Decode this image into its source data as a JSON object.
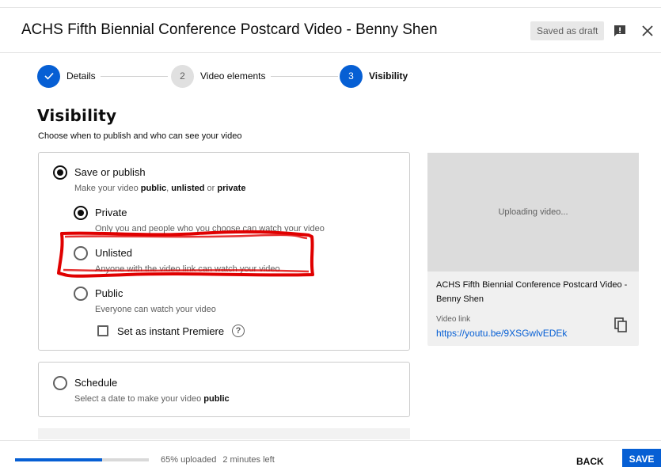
{
  "header": {
    "title": "ACHS Fifth Biennial Conference Postcard Video - Benny Shen",
    "draft_status": "Saved as draft",
    "feedback_icon": "feedback-icon",
    "close_icon": "close-icon"
  },
  "stepper": {
    "steps": [
      {
        "number": "✓",
        "label": "Details",
        "state": "done"
      },
      {
        "number": "2",
        "label": "Video elements",
        "state": "todo"
      },
      {
        "number": "3",
        "label": "Visibility",
        "state": "active"
      }
    ]
  },
  "visibility": {
    "heading": "Visibility",
    "subtitle": "Choose when to publish and who can see your video",
    "save_or_publish": {
      "label": "Save or publish",
      "desc_pre": "Make your video ",
      "desc_public": "public",
      "desc_mid1": ", ",
      "desc_unlisted": "unlisted",
      "desc_mid2": " or ",
      "desc_private": "private",
      "selected": true
    },
    "options": [
      {
        "label": "Private",
        "desc": "Only you and people who you choose can watch your video",
        "selected": true
      },
      {
        "label": "Unlisted",
        "desc": "Anyone with the video link can watch your video",
        "selected": false
      },
      {
        "label": "Public",
        "desc": "Everyone can watch your video",
        "selected": false
      }
    ],
    "premiere": {
      "label": "Set as instant Premiere",
      "checked": false,
      "help_icon": "help-icon"
    },
    "schedule": {
      "label": "Schedule",
      "desc_pre": "Select a date to make your video ",
      "desc_bold": "public",
      "selected": false
    }
  },
  "preview": {
    "status": "Uploading video...",
    "title": "ACHS Fifth Biennial Conference Postcard Video - Benny Shen",
    "link_label": "Video link",
    "link": "https://youtu.be/9XSGwlvEDEk",
    "copy_icon": "copy-icon"
  },
  "footer": {
    "progress_percent": 65,
    "uploaded_text": "65% uploaded",
    "time_left": "2 minutes left",
    "back_label": "BACK",
    "save_label": "SAVE"
  },
  "colors": {
    "accent": "#065fd4",
    "annotation": "#e00000"
  }
}
